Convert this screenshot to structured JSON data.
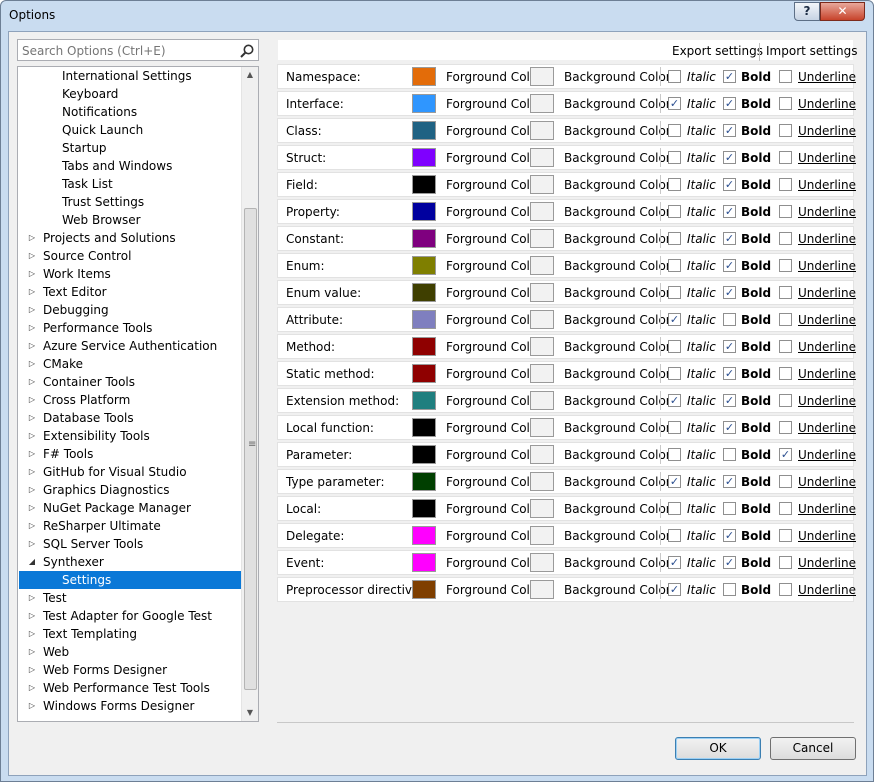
{
  "window": {
    "title": "Options",
    "help_label": "?",
    "close_label": "✕"
  },
  "search": {
    "placeholder": "Search Options (Ctrl+E)"
  },
  "tree": {
    "items": [
      {
        "label": "International Settings",
        "level": 2,
        "expander": "none"
      },
      {
        "label": "Keyboard",
        "level": 2,
        "expander": "none"
      },
      {
        "label": "Notifications",
        "level": 2,
        "expander": "none"
      },
      {
        "label": "Quick Launch",
        "level": 2,
        "expander": "none"
      },
      {
        "label": "Startup",
        "level": 2,
        "expander": "none"
      },
      {
        "label": "Tabs and Windows",
        "level": 2,
        "expander": "none"
      },
      {
        "label": "Task List",
        "level": 2,
        "expander": "none"
      },
      {
        "label": "Trust Settings",
        "level": 2,
        "expander": "none"
      },
      {
        "label": "Web Browser",
        "level": 2,
        "expander": "none"
      },
      {
        "label": "Projects and Solutions",
        "level": 1,
        "expander": "collapsed"
      },
      {
        "label": "Source Control",
        "level": 1,
        "expander": "collapsed"
      },
      {
        "label": "Work Items",
        "level": 1,
        "expander": "collapsed"
      },
      {
        "label": "Text Editor",
        "level": 1,
        "expander": "collapsed"
      },
      {
        "label": "Debugging",
        "level": 1,
        "expander": "collapsed"
      },
      {
        "label": "Performance Tools",
        "level": 1,
        "expander": "collapsed"
      },
      {
        "label": "Azure Service Authentication",
        "level": 1,
        "expander": "collapsed"
      },
      {
        "label": "CMake",
        "level": 1,
        "expander": "collapsed"
      },
      {
        "label": "Container Tools",
        "level": 1,
        "expander": "collapsed"
      },
      {
        "label": "Cross Platform",
        "level": 1,
        "expander": "collapsed"
      },
      {
        "label": "Database Tools",
        "level": 1,
        "expander": "collapsed"
      },
      {
        "label": "Extensibility Tools",
        "level": 1,
        "expander": "collapsed"
      },
      {
        "label": "F# Tools",
        "level": 1,
        "expander": "collapsed"
      },
      {
        "label": "GitHub for Visual Studio",
        "level": 1,
        "expander": "collapsed"
      },
      {
        "label": "Graphics Diagnostics",
        "level": 1,
        "expander": "collapsed"
      },
      {
        "label": "NuGet Package Manager",
        "level": 1,
        "expander": "collapsed"
      },
      {
        "label": "ReSharper Ultimate",
        "level": 1,
        "expander": "collapsed"
      },
      {
        "label": "SQL Server Tools",
        "level": 1,
        "expander": "collapsed"
      },
      {
        "label": "Synthexer",
        "level": 1,
        "expander": "expanded"
      },
      {
        "label": "Settings",
        "level": 2,
        "expander": "none",
        "selected": true
      },
      {
        "label": "Test",
        "level": 1,
        "expander": "collapsed"
      },
      {
        "label": "Test Adapter for Google Test",
        "level": 1,
        "expander": "collapsed"
      },
      {
        "label": "Text Templating",
        "level": 1,
        "expander": "collapsed"
      },
      {
        "label": "Web",
        "level": 1,
        "expander": "collapsed"
      },
      {
        "label": "Web Forms Designer",
        "level": 1,
        "expander": "collapsed"
      },
      {
        "label": "Web Performance Test Tools",
        "level": 1,
        "expander": "collapsed"
      },
      {
        "label": "Windows Forms Designer",
        "level": 1,
        "expander": "collapsed"
      }
    ]
  },
  "header": {
    "export_label": "Export settings",
    "import_label": "Import settings"
  },
  "rows": [
    {
      "name": "Namespace:",
      "color": "#e36c09",
      "italic": false,
      "bold": true,
      "underline": false
    },
    {
      "name": "Interface:",
      "color": "#2f96ff",
      "italic": true,
      "bold": true,
      "underline": false
    },
    {
      "name": "Class:",
      "color": "#1f6283",
      "italic": false,
      "bold": true,
      "underline": false
    },
    {
      "name": "Struct:",
      "color": "#7f00ff",
      "italic": false,
      "bold": true,
      "underline": false
    },
    {
      "name": "Field:",
      "color": "#000000",
      "italic": false,
      "bold": true,
      "underline": false
    },
    {
      "name": "Property:",
      "color": "#00009f",
      "italic": false,
      "bold": true,
      "underline": false
    },
    {
      "name": "Constant:",
      "color": "#7f007f",
      "italic": false,
      "bold": true,
      "underline": false
    },
    {
      "name": "Enum:",
      "color": "#7f7f00",
      "italic": false,
      "bold": true,
      "underline": false
    },
    {
      "name": "Enum value:",
      "color": "#3f3f00",
      "italic": false,
      "bold": true,
      "underline": false
    },
    {
      "name": "Attribute:",
      "color": "#7f7fbf",
      "italic": true,
      "bold": false,
      "underline": false
    },
    {
      "name": "Method:",
      "color": "#8f0000",
      "italic": false,
      "bold": true,
      "underline": false
    },
    {
      "name": "Static method:",
      "color": "#8f0000",
      "italic": false,
      "bold": true,
      "underline": false
    },
    {
      "name": "Extension method:",
      "color": "#1f7f7f",
      "italic": true,
      "bold": true,
      "underline": false
    },
    {
      "name": "Local function:",
      "color": "#000000",
      "italic": false,
      "bold": true,
      "underline": false
    },
    {
      "name": "Parameter:",
      "color": "#000000",
      "italic": false,
      "bold": false,
      "underline": true
    },
    {
      "name": "Type parameter:",
      "color": "#003f00",
      "italic": true,
      "bold": true,
      "underline": false
    },
    {
      "name": "Local:",
      "color": "#000000",
      "italic": false,
      "bold": false,
      "underline": false
    },
    {
      "name": "Delegate:",
      "color": "#ff00ff",
      "italic": false,
      "bold": true,
      "underline": false
    },
    {
      "name": "Event:",
      "color": "#ff00ff",
      "italic": true,
      "bold": true,
      "underline": false
    },
    {
      "name": "Preprocessor directive:",
      "color": "#7f3f00",
      "italic": true,
      "bold": false,
      "underline": false
    }
  ],
  "labels": {
    "foreground": "Forground Color",
    "background": "Background Color",
    "italic": "Italic",
    "bold": "Bold",
    "underline": "Underline"
  },
  "footer": {
    "ok_label": "OK",
    "cancel_label": "Cancel"
  }
}
